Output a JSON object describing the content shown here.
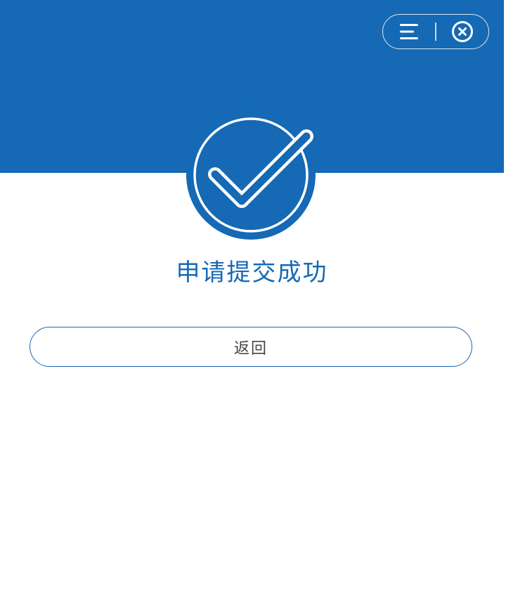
{
  "colors": {
    "primary": "#1569b5",
    "background": "#ffffff",
    "button_text": "#444444"
  },
  "header": {
    "capsule": {
      "menu_icon": "menu-icon",
      "close_icon": "close-circle-icon"
    }
  },
  "status": {
    "icon": "check-circle-icon",
    "title": "申请提交成功"
  },
  "actions": {
    "back_label": "返回"
  }
}
